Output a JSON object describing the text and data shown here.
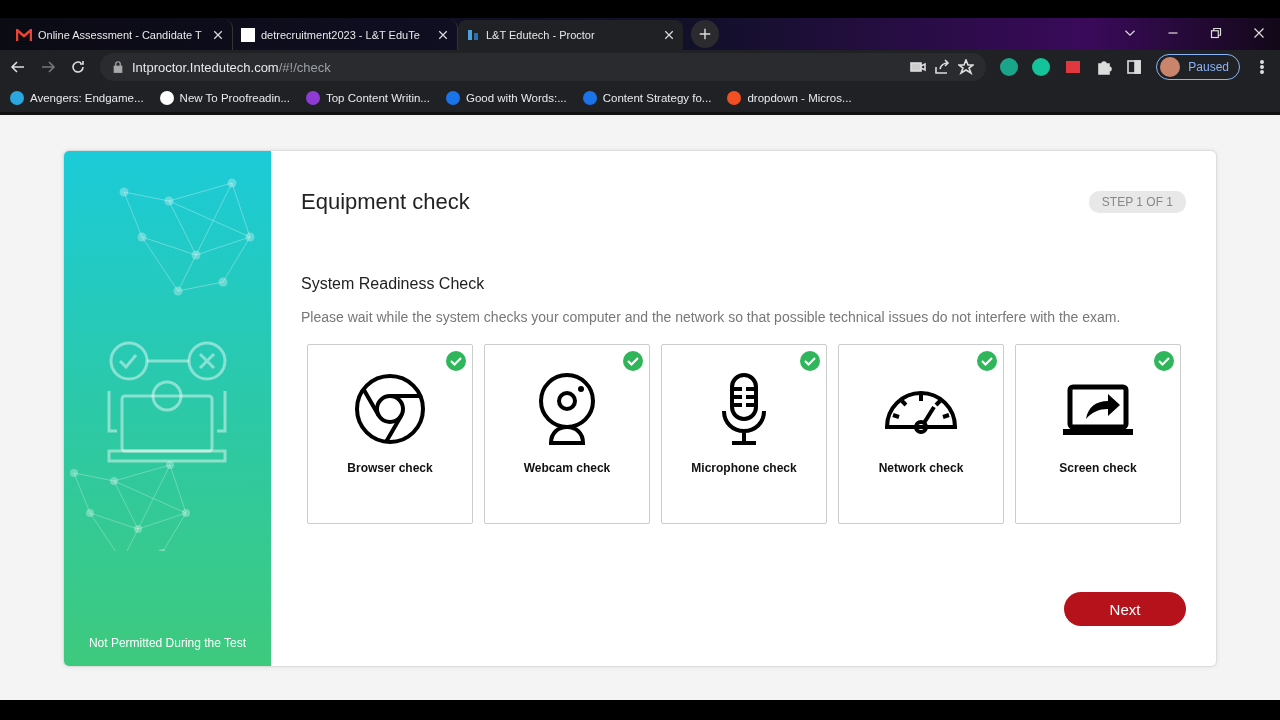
{
  "browser": {
    "tabs": [
      {
        "title": "Online Assessment - Candidate T",
        "selected": false,
        "kind": "mail"
      },
      {
        "title": "detrecruitment2023 - L&T EduTe",
        "selected": false,
        "kind": "blank"
      },
      {
        "title": "L&T Edutech - Proctor",
        "selected": true,
        "kind": "logo"
      }
    ],
    "url_host": "Intproctor.Intedutech.com",
    "url_path": "/#!/check",
    "profile_status": "Paused",
    "bookmarks": [
      {
        "label": "Avengers: Endgame...",
        "color": "#2aa7e0"
      },
      {
        "label": "New To Proofreadin...",
        "color": "#ffffff"
      },
      {
        "label": "Top Content Writin...",
        "color": "#8e3bd6"
      },
      {
        "label": "Good with Words:...",
        "color": "#1a73e8"
      },
      {
        "label": "Content Strategy fo...",
        "color": "#1a73e8"
      },
      {
        "label": "dropdown - Micros...",
        "color": "#f25022"
      }
    ]
  },
  "sidebar": {
    "footer": "Not Permitted During the Test"
  },
  "page": {
    "title": "Equipment check",
    "step": "STEP 1 OF 1",
    "section_title": "System Readiness Check",
    "description": "Please wait while the system checks your computer and the network so that possible technical issues do not interfere with the exam.",
    "checks": [
      {
        "kind": "browser",
        "label": "Browser check",
        "passed": true
      },
      {
        "kind": "webcam",
        "label": "Webcam check",
        "passed": true
      },
      {
        "kind": "microphone",
        "label": "Microphone check",
        "passed": true
      },
      {
        "kind": "network",
        "label": "Network check",
        "passed": true
      },
      {
        "kind": "screen",
        "label": "Screen check",
        "passed": true
      }
    ],
    "next_button": "Next"
  }
}
